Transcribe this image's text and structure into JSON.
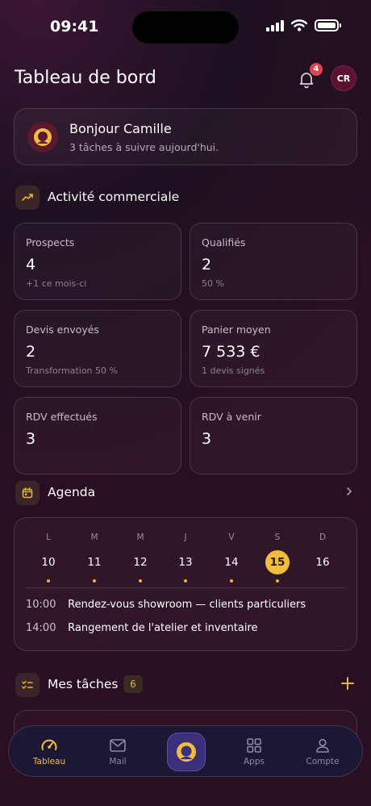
{
  "status_bar": {
    "time": "09:41"
  },
  "header": {
    "title": "Tableau de bord",
    "notification_count": "4",
    "avatar_initials": "CR"
  },
  "greeting": {
    "title": "Bonjour Camille",
    "subtitle": "3 tâches à suivre aujourd'hui."
  },
  "activity": {
    "title": "Activité commerciale",
    "stats": [
      {
        "label": "Prospects",
        "value": "4",
        "sub": "+1 ce mois-ci"
      },
      {
        "label": "Qualifiés",
        "value": "2",
        "sub": "50 %"
      },
      {
        "label": "Devis envoyés",
        "value": "2",
        "sub": "Transformation 50 %"
      },
      {
        "label": "Panier moyen",
        "value": "7 533 €",
        "sub": "1 devis signés"
      },
      {
        "label": "RDV effectués",
        "value": "3",
        "sub": ""
      },
      {
        "label": "RDV à venir",
        "value": "3",
        "sub": ""
      }
    ]
  },
  "agenda": {
    "title": "Agenda",
    "days": [
      {
        "letter": "L",
        "num": "10"
      },
      {
        "letter": "M",
        "num": "11"
      },
      {
        "letter": "M",
        "num": "12"
      },
      {
        "letter": "J",
        "num": "13"
      },
      {
        "letter": "V",
        "num": "14"
      },
      {
        "letter": "S",
        "num": "15",
        "selected": true
      },
      {
        "letter": "D",
        "num": "16"
      }
    ],
    "events": [
      {
        "time": "10:00",
        "title": "Rendez-vous showroom — clients particuliers"
      },
      {
        "time": "14:00",
        "title": "Rangement de l'atelier et inventaire"
      }
    ]
  },
  "tasks": {
    "title": "Mes tâches",
    "count": "6"
  },
  "tabbar": {
    "items": [
      {
        "label": "Tableau",
        "icon": "gauge-icon",
        "active": true
      },
      {
        "label": "Mail",
        "icon": "mail-icon"
      },
      {
        "label": "",
        "icon": "brand-logo-icon"
      },
      {
        "label": "Apps",
        "icon": "grid-icon"
      },
      {
        "label": "Compte",
        "icon": "user-icon"
      }
    ]
  },
  "colors": {
    "accent": "#f1bd3b",
    "badge": "#e0434c",
    "background": "#1d1020"
  }
}
